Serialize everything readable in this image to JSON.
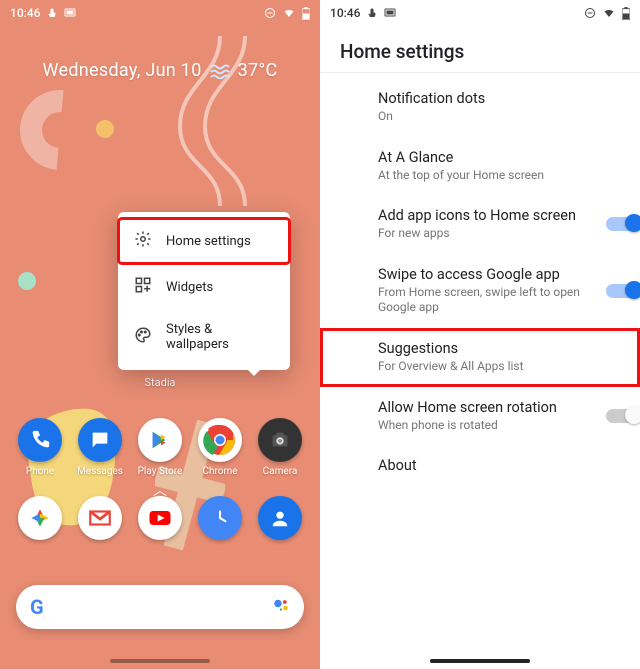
{
  "left": {
    "status": {
      "time": "10:46"
    },
    "date": "Wednesday, Jun 10",
    "temp": "37°C",
    "popup": {
      "items": [
        {
          "label": "Home settings",
          "icon": "gear-icon",
          "highlight": true
        },
        {
          "label": "Widgets",
          "icon": "widgets-icon"
        },
        {
          "label": "Styles & wallpapers",
          "icon": "palette-icon"
        }
      ]
    },
    "under_label": "Stadia",
    "row1": [
      {
        "label": "Phone"
      },
      {
        "label": "Messages"
      },
      {
        "label": "Play Store"
      },
      {
        "label": "Chrome"
      },
      {
        "label": "Camera"
      }
    ],
    "row2_count": 5
  },
  "right": {
    "status": {
      "time": "10:46"
    },
    "title": "Home settings",
    "items": [
      {
        "title": "Notification dots",
        "sub": "On",
        "toggle": null
      },
      {
        "title": "At A Glance",
        "sub": "At the top of your Home screen",
        "toggle": null
      },
      {
        "title": "Add app icons to Home screen",
        "sub": "For new apps",
        "toggle": "on"
      },
      {
        "title": "Swipe to access Google app",
        "sub": "From Home screen, swipe left to open Google app",
        "toggle": "on"
      },
      {
        "title": "Suggestions",
        "sub": "For Overview & All Apps list",
        "toggle": null,
        "highlight": true
      },
      {
        "title": "Allow Home screen rotation",
        "sub": "When phone is rotated",
        "toggle": "off"
      },
      {
        "title": "About",
        "sub": "",
        "toggle": null
      }
    ]
  }
}
